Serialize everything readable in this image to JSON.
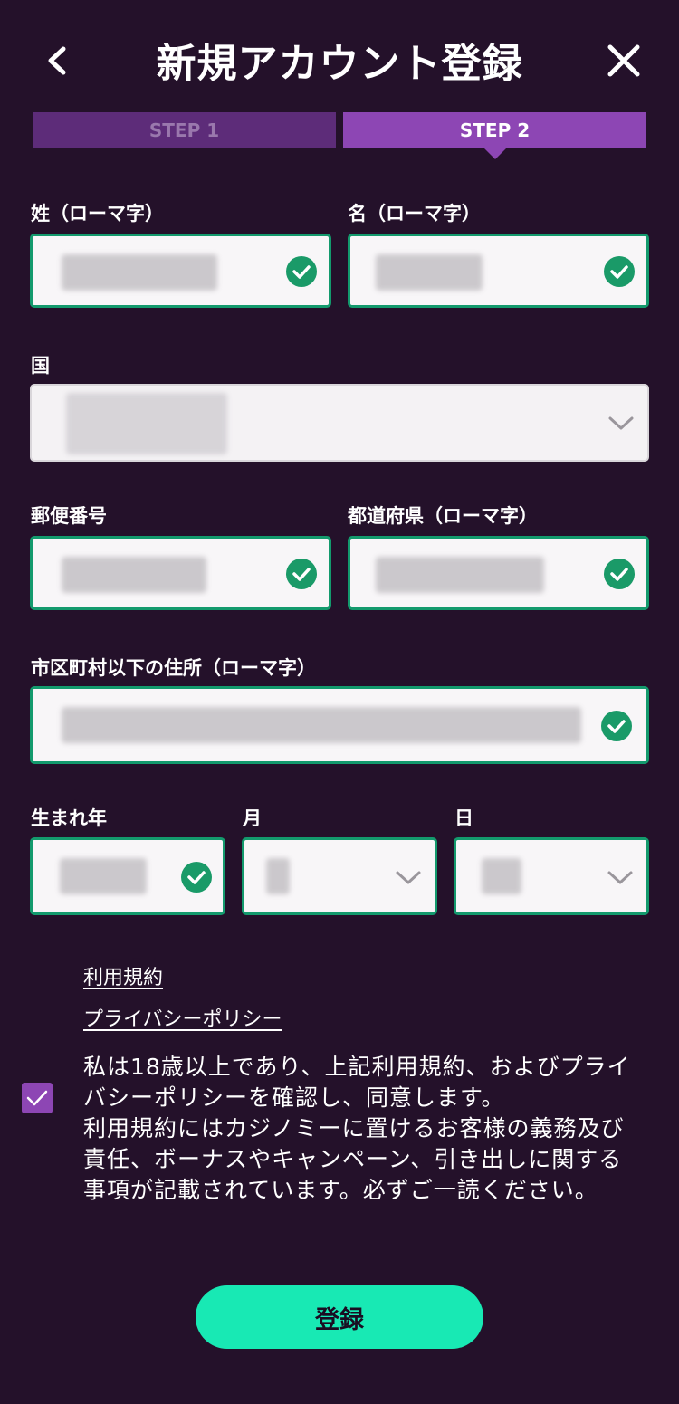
{
  "header": {
    "title": "新規アカウント登録",
    "back_icon": "chevron-left-icon",
    "close_icon": "close-icon"
  },
  "steps": [
    {
      "label": "STEP 1",
      "active": false
    },
    {
      "label": "STEP 2",
      "active": true
    }
  ],
  "form": {
    "last_name_label": "姓（ローマ字）",
    "first_name_label": "名（ローマ字）",
    "country_label": "国",
    "postal_code_label": "郵便番号",
    "prefecture_label": "都道府県（ローマ字）",
    "address_label": "市区町村以下の住所（ローマ字）",
    "birth_year_label": "生まれ年",
    "birth_month_label": "月",
    "birth_day_label": "日"
  },
  "links": {
    "terms": "利用規約",
    "privacy": "プライバシーポリシー"
  },
  "consent": {
    "checked": true,
    "text_1": "私は18歳以上であり、上記利用規約、およびプライバシーポリシーを確認し、同意します。",
    "text_2": "利用規約にはカジノミーに置けるお客様の義務及び責任、ボーナスやキャンペーン、引き出しに関する事項が記載されています。必ずご一読ください。"
  },
  "submit_label": "登録",
  "colors": {
    "background": "#24112a",
    "step_active": "#8d46b4",
    "step_inactive": "#5d2c79",
    "valid_border": "#139a6d",
    "check": "#1a9a68",
    "submit": "#18e9b4"
  }
}
